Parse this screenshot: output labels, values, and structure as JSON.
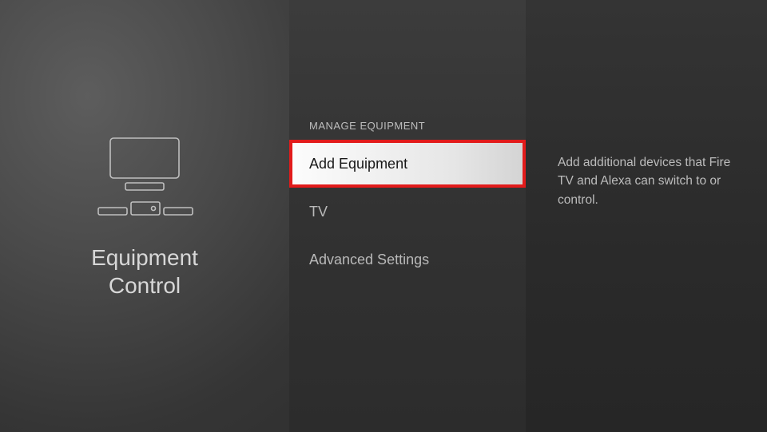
{
  "left": {
    "title": "Equipment\nControl"
  },
  "menu": {
    "header": "MANAGE EQUIPMENT",
    "items": {
      "add_equipment": "Add Equipment",
      "tv": "TV",
      "advanced_settings": "Advanced Settings"
    }
  },
  "help": {
    "text": "Add additional devices that Fire TV and Alexa can switch to or control."
  }
}
